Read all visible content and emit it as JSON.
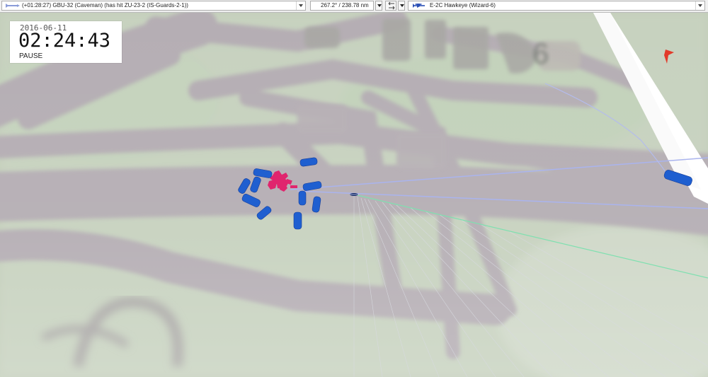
{
  "toolbar": {
    "event_text": "(+01:28:27) GBU-32 (Caveman) (has hit ZU-23-2 (IS-Guards-2-1))",
    "bearing_text": "267.2° / 238.78 nm",
    "unit_text": "E-2C Hawkeye (Wizard-6)"
  },
  "clock": {
    "date": "2016-06-11",
    "time": "02:24:43",
    "state": "PAUSE"
  },
  "colors": {
    "friendly": "#1f5fd0",
    "enemy": "#e0256e",
    "track_line": "#aab4ee",
    "target_line": "#7fe0b0"
  }
}
